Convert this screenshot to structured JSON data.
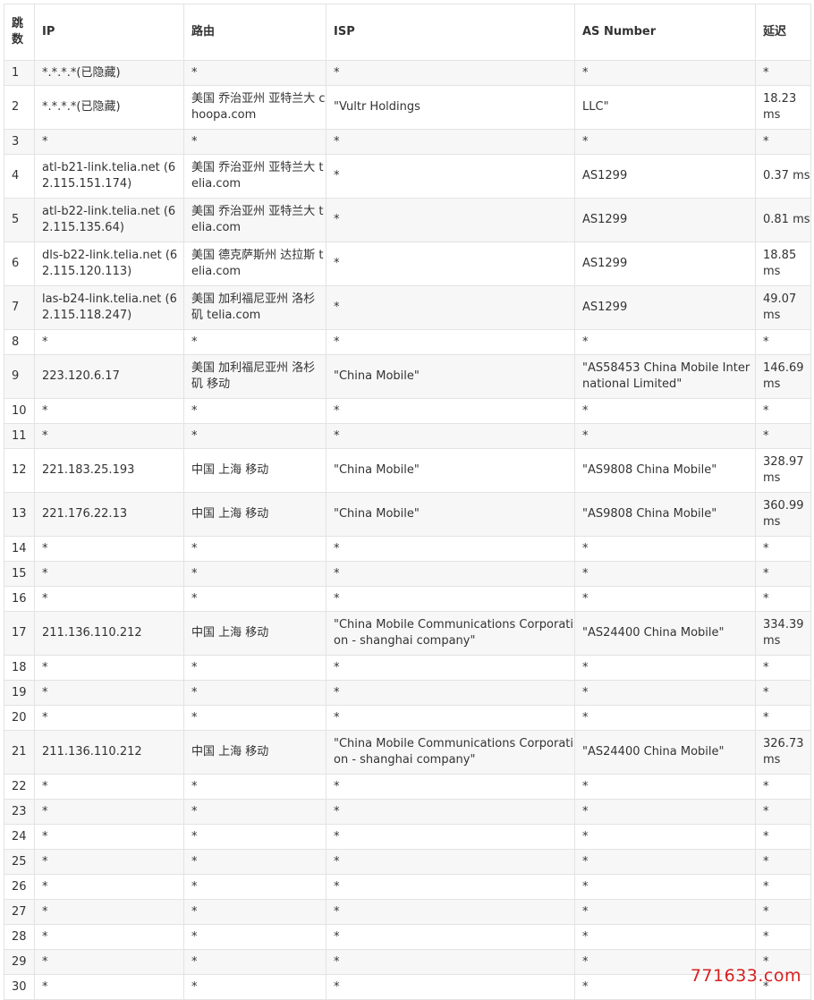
{
  "table": {
    "headers": {
      "hop": "跳数",
      "ip": "IP",
      "route": "路由",
      "isp": "ISP",
      "as": "AS Number",
      "latency": "延迟"
    },
    "rows": [
      {
        "hop": "1",
        "ip": "*.*.*.*(已隐藏)",
        "route": "*",
        "isp": "*",
        "as": "*",
        "latency": "*"
      },
      {
        "hop": "2",
        "ip": "*.*.*.*(已隐藏)",
        "route": "美国 乔治亚州 亚特兰大 choopa.com",
        "isp": "\"Vultr Holdings",
        "as": "LLC\"",
        "latency": "18.23 ms"
      },
      {
        "hop": "3",
        "ip": "*",
        "route": "*",
        "isp": "*",
        "as": "*",
        "latency": "*"
      },
      {
        "hop": "4",
        "ip": "atl-b21-link.telia.net (62.115.151.174)",
        "route": "美国 乔治亚州 亚特兰大 telia.com",
        "isp": "*",
        "as": "AS1299",
        "latency": "0.37 ms"
      },
      {
        "hop": "5",
        "ip": "atl-b22-link.telia.net (62.115.135.64)",
        "route": "美国 乔治亚州 亚特兰大 telia.com",
        "isp": "*",
        "as": "AS1299",
        "latency": "0.81 ms"
      },
      {
        "hop": "6",
        "ip": "dls-b22-link.telia.net (62.115.120.113)",
        "route": "美国 德克萨斯州 达拉斯 telia.com",
        "isp": "*",
        "as": "AS1299",
        "latency": "18.85 ms"
      },
      {
        "hop": "7",
        "ip": "las-b24-link.telia.net (62.115.118.247)",
        "route": "美国 加利福尼亚州 洛杉矶 telia.com",
        "isp": "*",
        "as": "AS1299",
        "latency": "49.07 ms"
      },
      {
        "hop": "8",
        "ip": "*",
        "route": "*",
        "isp": "*",
        "as": "*",
        "latency": "*"
      },
      {
        "hop": "9",
        "ip": "223.120.6.17",
        "route": "美国 加利福尼亚州 洛杉矶 移动",
        "isp": "\"China Mobile\"",
        "as": "\"AS58453 China Mobile International Limited\"",
        "latency": "146.69 ms"
      },
      {
        "hop": "10",
        "ip": "*",
        "route": "*",
        "isp": "*",
        "as": "*",
        "latency": "*"
      },
      {
        "hop": "11",
        "ip": "*",
        "route": "*",
        "isp": "*",
        "as": "*",
        "latency": "*"
      },
      {
        "hop": "12",
        "ip": "221.183.25.193",
        "route": "中国 上海 移动",
        "isp": "\"China Mobile\"",
        "as": "\"AS9808 China Mobile\"",
        "latency": "328.97 ms"
      },
      {
        "hop": "13",
        "ip": "221.176.22.13",
        "route": "中国 上海 移动",
        "isp": "\"China Mobile\"",
        "as": "\"AS9808 China Mobile\"",
        "latency": "360.99 ms"
      },
      {
        "hop": "14",
        "ip": "*",
        "route": "*",
        "isp": "*",
        "as": "*",
        "latency": "*"
      },
      {
        "hop": "15",
        "ip": "*",
        "route": "*",
        "isp": "*",
        "as": "*",
        "latency": "*"
      },
      {
        "hop": "16",
        "ip": "*",
        "route": "*",
        "isp": "*",
        "as": "*",
        "latency": "*"
      },
      {
        "hop": "17",
        "ip": "211.136.110.212",
        "route": "中国 上海 移动",
        "isp": "\"China Mobile Communications Corporation - shanghai company\"",
        "as": "\"AS24400 China Mobile\"",
        "latency": "334.39 ms"
      },
      {
        "hop": "18",
        "ip": "*",
        "route": "*",
        "isp": "*",
        "as": "*",
        "latency": "*"
      },
      {
        "hop": "19",
        "ip": "*",
        "route": "*",
        "isp": "*",
        "as": "*",
        "latency": "*"
      },
      {
        "hop": "20",
        "ip": "*",
        "route": "*",
        "isp": "*",
        "as": "*",
        "latency": "*"
      },
      {
        "hop": "21",
        "ip": "211.136.110.212",
        "route": "中国 上海 移动",
        "isp": "\"China Mobile Communications Corporation - shanghai company\"",
        "as": "\"AS24400 China Mobile\"",
        "latency": "326.73 ms"
      },
      {
        "hop": "22",
        "ip": "*",
        "route": "*",
        "isp": "*",
        "as": "*",
        "latency": "*"
      },
      {
        "hop": "23",
        "ip": "*",
        "route": "*",
        "isp": "*",
        "as": "*",
        "latency": "*"
      },
      {
        "hop": "24",
        "ip": "*",
        "route": "*",
        "isp": "*",
        "as": "*",
        "latency": "*"
      },
      {
        "hop": "25",
        "ip": "*",
        "route": "*",
        "isp": "*",
        "as": "*",
        "latency": "*"
      },
      {
        "hop": "26",
        "ip": "*",
        "route": "*",
        "isp": "*",
        "as": "*",
        "latency": "*"
      },
      {
        "hop": "27",
        "ip": "*",
        "route": "*",
        "isp": "*",
        "as": "*",
        "latency": "*"
      },
      {
        "hop": "28",
        "ip": "*",
        "route": "*",
        "isp": "*",
        "as": "*",
        "latency": "*"
      },
      {
        "hop": "29",
        "ip": "*",
        "route": "*",
        "isp": "*",
        "as": "*",
        "latency": "*"
      },
      {
        "hop": "30",
        "ip": "*",
        "route": "*",
        "isp": "*",
        "as": "*",
        "latency": "*"
      }
    ]
  },
  "watermark": "771633.com"
}
